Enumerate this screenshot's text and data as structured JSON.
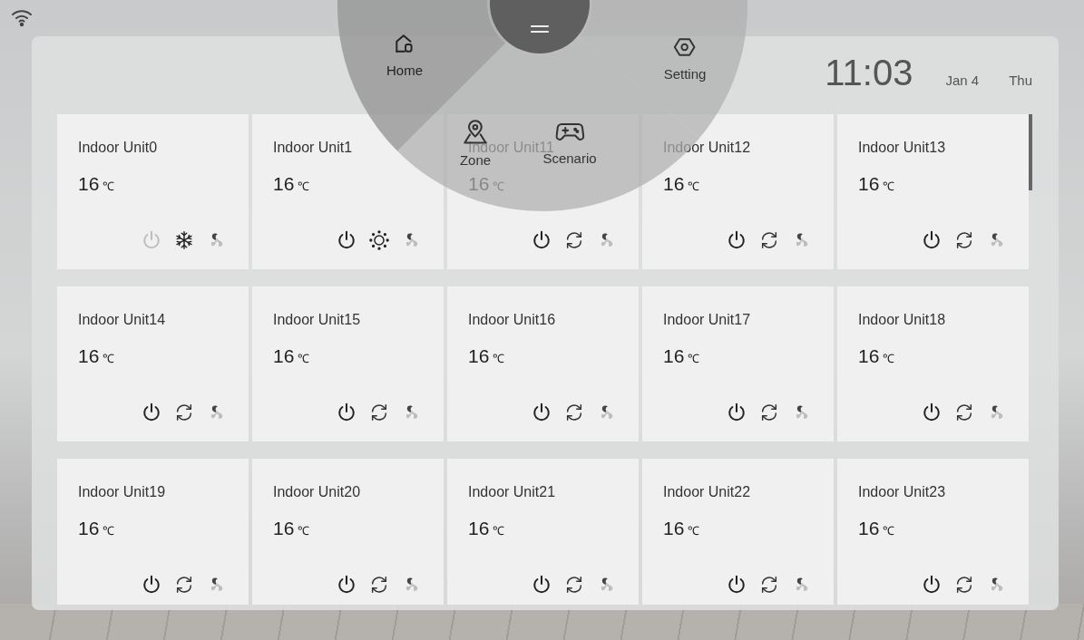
{
  "menu": {
    "items": [
      {
        "label": "Home",
        "kind": "home",
        "selected": true
      },
      {
        "label": "Setting",
        "kind": "setting",
        "selected": false
      },
      {
        "label": "Zone",
        "kind": "zone",
        "selected": false
      },
      {
        "label": "Scenario",
        "kind": "scenario",
        "selected": false
      }
    ]
  },
  "clock": {
    "time": "11:03",
    "date": "Jan 4",
    "weekday": "Thu"
  },
  "units": [
    {
      "name": "Indoor Unit0",
      "temp": "16",
      "unit": "℃",
      "on": false,
      "kind": "cool"
    },
    {
      "name": "Indoor Unit1",
      "temp": "16",
      "unit": "℃",
      "on": true,
      "kind": "heat"
    },
    {
      "name": "Indoor Unit11",
      "temp": "16",
      "unit": "℃",
      "on": true,
      "kind": "auto"
    },
    {
      "name": "Indoor Unit12",
      "temp": "16",
      "unit": "℃",
      "on": true,
      "kind": "auto"
    },
    {
      "name": "Indoor Unit13",
      "temp": "16",
      "unit": "℃",
      "on": true,
      "kind": "auto"
    },
    {
      "name": "Indoor Unit14",
      "temp": "16",
      "unit": "℃",
      "on": true,
      "kind": "auto"
    },
    {
      "name": "Indoor Unit15",
      "temp": "16",
      "unit": "℃",
      "on": true,
      "kind": "auto"
    },
    {
      "name": "Indoor Unit16",
      "temp": "16",
      "unit": "℃",
      "on": true,
      "kind": "auto"
    },
    {
      "name": "Indoor Unit17",
      "temp": "16",
      "unit": "℃",
      "on": true,
      "kind": "auto"
    },
    {
      "name": "Indoor Unit18",
      "temp": "16",
      "unit": "℃",
      "on": true,
      "kind": "auto"
    },
    {
      "name": "Indoor Unit19",
      "temp": "16",
      "unit": "℃",
      "on": true,
      "kind": "auto"
    },
    {
      "name": "Indoor Unit20",
      "temp": "16",
      "unit": "℃",
      "on": true,
      "kind": "auto"
    },
    {
      "name": "Indoor Unit21",
      "temp": "16",
      "unit": "℃",
      "on": true,
      "kind": "auto"
    },
    {
      "name": "Indoor Unit22",
      "temp": "16",
      "unit": "℃",
      "on": true,
      "kind": "auto"
    },
    {
      "name": "Indoor Unit23",
      "temp": "16",
      "unit": "℃",
      "on": true,
      "kind": "auto"
    }
  ]
}
